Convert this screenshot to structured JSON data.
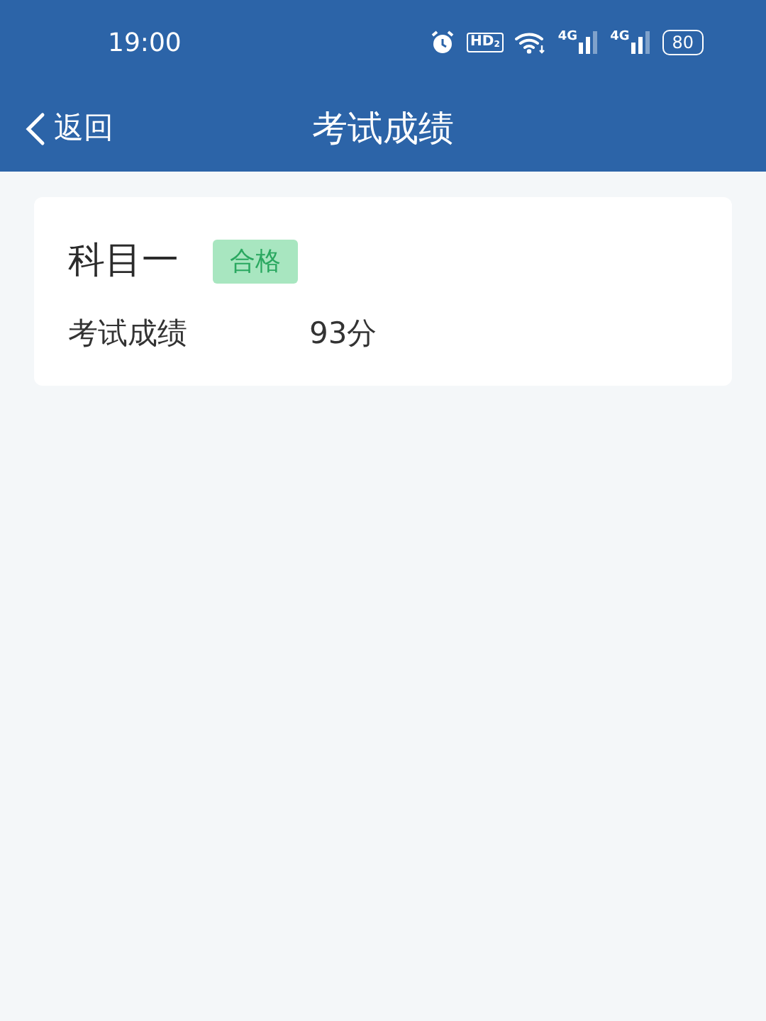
{
  "status_bar": {
    "time": "19:00",
    "icons": [
      {
        "kind": "alarm"
      },
      {
        "kind": "hd",
        "label": "HD",
        "sub": "2"
      },
      {
        "kind": "wifi"
      },
      {
        "kind": "signal",
        "label": "4G"
      },
      {
        "kind": "signal",
        "label": "4G"
      },
      {
        "kind": "battery",
        "label": "80"
      }
    ]
  },
  "navbar": {
    "back": "返回",
    "title": "考试成绩"
  },
  "results": [
    {
      "subject": "科目一",
      "status": "合格",
      "passed": true,
      "score_label": "考试成绩",
      "score": "93分"
    }
  ]
}
